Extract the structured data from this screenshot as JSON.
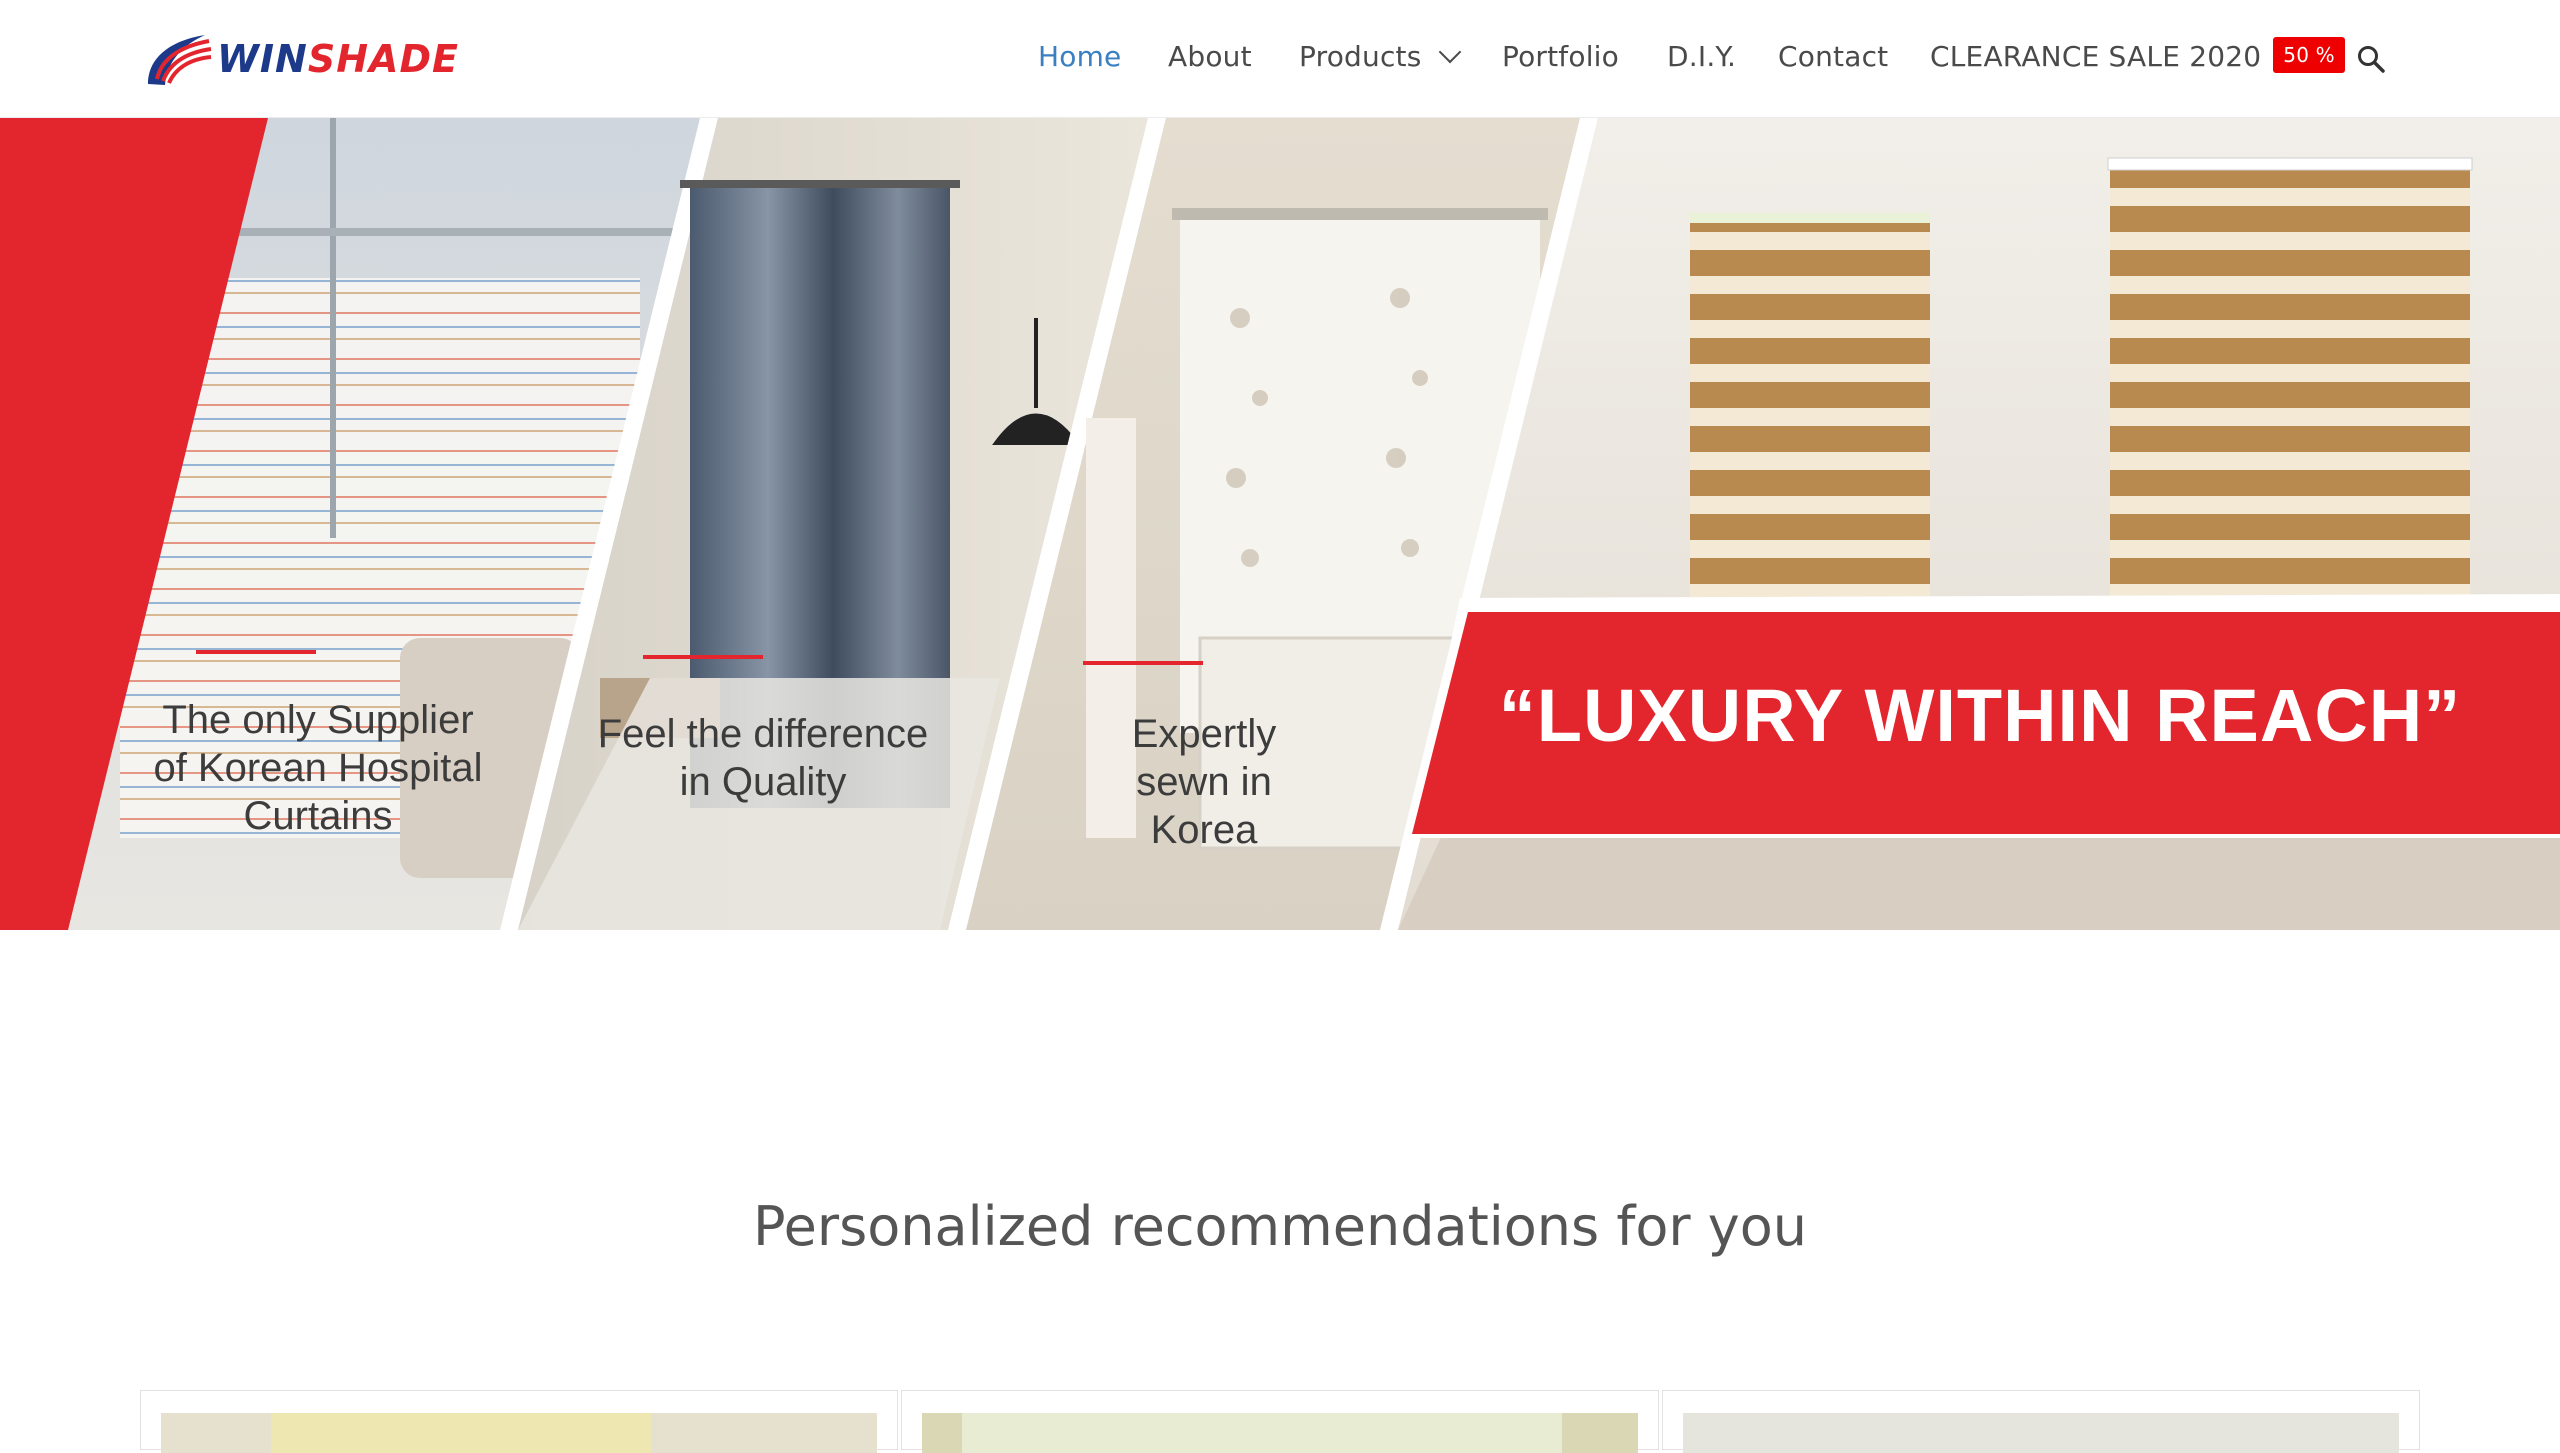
{
  "brand": {
    "logo_alt": "WINSHADE",
    "logo_win": "WIN",
    "logo_shade": "SHADE",
    "colors": {
      "blue": "#1d3a8a",
      "red": "#e3262d"
    }
  },
  "nav": {
    "items": [
      {
        "label": "Home",
        "active": true
      },
      {
        "label": "About"
      },
      {
        "label": "Products",
        "has_dropdown": true
      },
      {
        "label": "Portfolio"
      },
      {
        "label": "D.I.Y."
      },
      {
        "label": "Contact"
      },
      {
        "label": "CLEARANCE SALE 2020",
        "badge": "50 %"
      }
    ],
    "search_icon": "search-icon",
    "active_color": "#3a7fc1"
  },
  "hero": {
    "panels": [
      {
        "text": "The only Supplier of Korean Hospital Curtains"
      },
      {
        "text": "Feel the difference in Quality"
      },
      {
        "text": "Expertly sewn in Korea"
      }
    ],
    "banner": "“LUXURY WITHIN REACH”",
    "accent": "#e3262d"
  },
  "recommendations": {
    "title": "Personalized recommendations for you",
    "cards": [
      {
        "name": "recommendation-card-1"
      },
      {
        "name": "recommendation-card-2"
      },
      {
        "name": "recommendation-card-3"
      }
    ]
  }
}
